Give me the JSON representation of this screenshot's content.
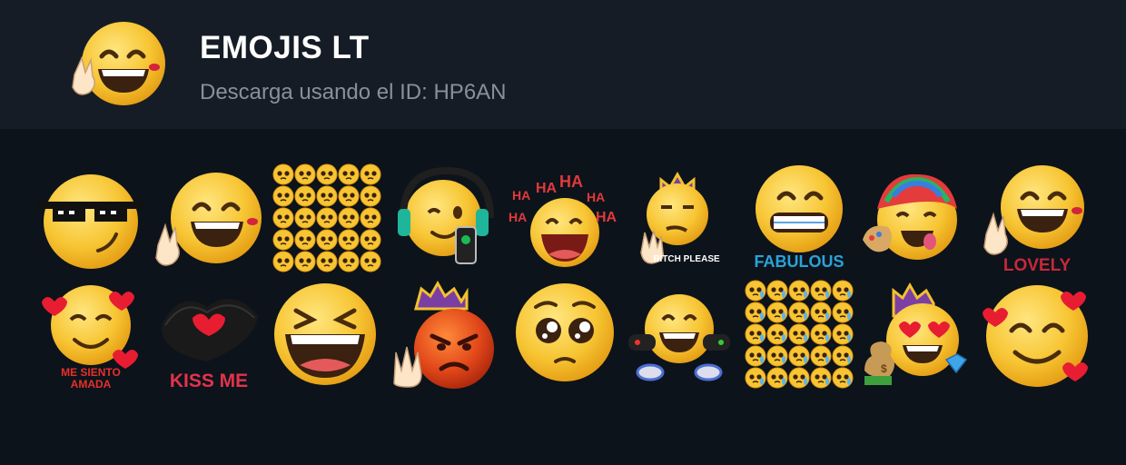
{
  "pack": {
    "title": "EMOJIS LT",
    "subtitle": "Descarga usando el ID: HP6AN"
  },
  "stickers": [
    {
      "name": "sticker-sunglasses",
      "caption": ""
    },
    {
      "name": "sticker-peace-grin",
      "caption": ""
    },
    {
      "name": "sticker-pleading-grid",
      "caption": ""
    },
    {
      "name": "sticker-headphones-wink",
      "caption": ""
    },
    {
      "name": "sticker-hahaha",
      "caption": "HA"
    },
    {
      "name": "sticker-bitch-please",
      "caption": "BITCH PLEASE"
    },
    {
      "name": "sticker-fabulous",
      "caption": "FABULOUS"
    },
    {
      "name": "sticker-rainbow-hair",
      "caption": ""
    },
    {
      "name": "sticker-lovely",
      "caption": "LOVELY"
    },
    {
      "name": "sticker-me-siento-amada",
      "caption": "ME SIENTO AMADA"
    },
    {
      "name": "sticker-kiss-me",
      "caption": "KISS ME"
    },
    {
      "name": "sticker-laughing",
      "caption": ""
    },
    {
      "name": "sticker-angry-king",
      "caption": ""
    },
    {
      "name": "sticker-pleading",
      "caption": ""
    },
    {
      "name": "sticker-gamer",
      "caption": ""
    },
    {
      "name": "sticker-crying-grid",
      "caption": ""
    },
    {
      "name": "sticker-rich-king",
      "caption": ""
    },
    {
      "name": "sticker-hearts-smile",
      "caption": ""
    }
  ],
  "colors": {
    "background": "#0d131b",
    "header": "#151c25",
    "emoji_yellow": "#f6c630",
    "caption_red": "#c8283a",
    "caption_blue": "#2aa3d8"
  }
}
